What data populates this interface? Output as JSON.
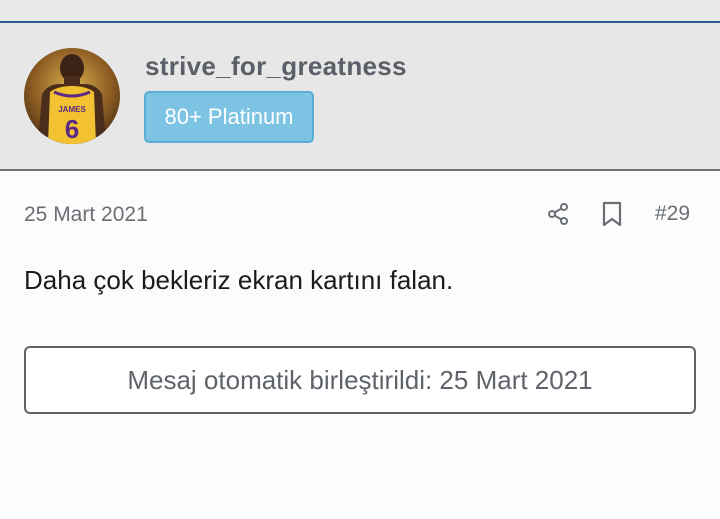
{
  "user": {
    "username": "strive_for_greatness",
    "badge": "80+ Platinum",
    "avatar_icon": "player-avatar",
    "jersey_name": "JAMES",
    "jersey_number": "6",
    "badge_color": "#7dc3e3"
  },
  "post": {
    "date": "25 Mart 2021",
    "number": "#29",
    "message": "Daha çok bekleriz ekran kartını falan.",
    "merge_notice": "Mesaj otomatik birleştirildi: 25 Mart 2021",
    "actions": [
      "share-icon",
      "bookmark-icon"
    ]
  }
}
